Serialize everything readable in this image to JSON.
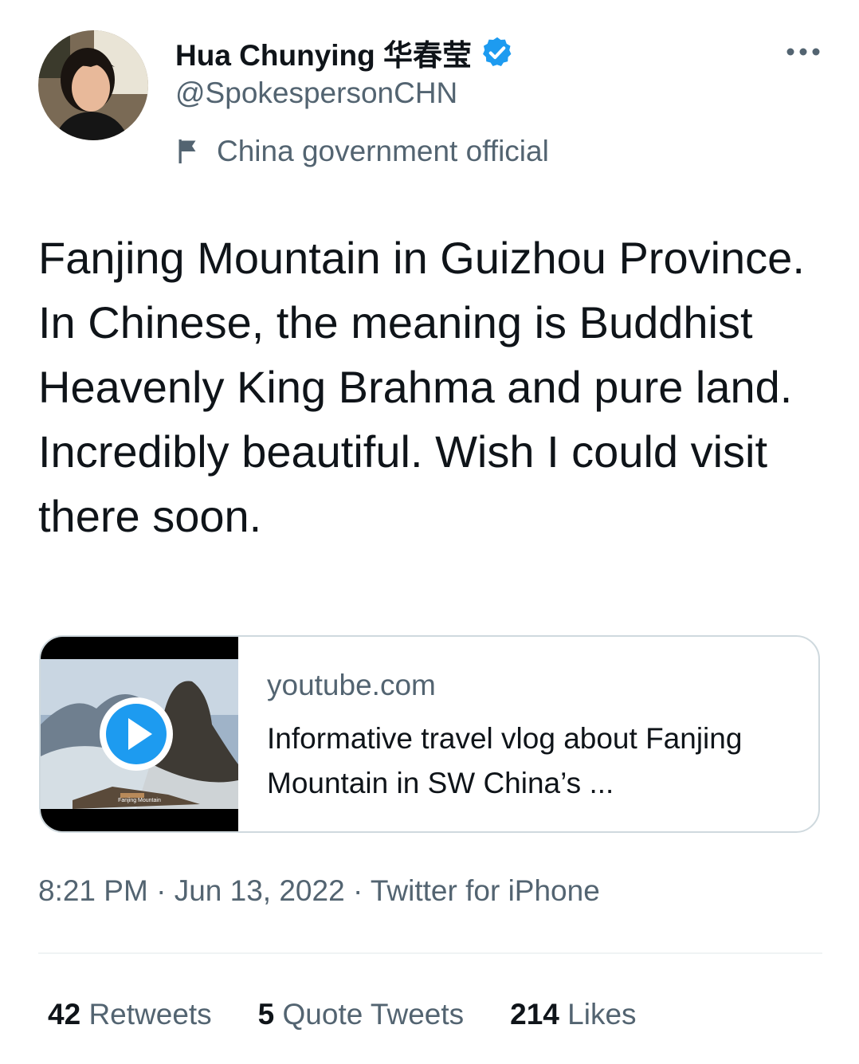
{
  "author": {
    "display_name": "Hua Chunying 华春莹",
    "handle": "@SpokespersonCHN",
    "label": "China government official",
    "verified": true,
    "verified_color": "#1d9bf0"
  },
  "more_icon": "more-horizontal-icon",
  "tweet": {
    "text": "Fanjing Mountain in Guizhou Province. In Chinese, the meaning is Buddhist Heavenly King Brahma and pure land. Incredibly beautiful. Wish I could visit there soon."
  },
  "card": {
    "domain": "youtube.com",
    "title": "Informative travel vlog about Fanjing Mountain in SW China’s ...",
    "play_icon": "play-icon",
    "thumb_caption": "Fanjing Mountain"
  },
  "meta": {
    "time": "8:21 PM",
    "date": "Jun 13, 2022",
    "source": "Twitter for iPhone"
  },
  "stats": {
    "retweets_count": "42",
    "retweets_label": "Retweets",
    "quotes_count": "5",
    "quotes_label": "Quote Tweets",
    "likes_count": "214",
    "likes_label": "Likes"
  }
}
